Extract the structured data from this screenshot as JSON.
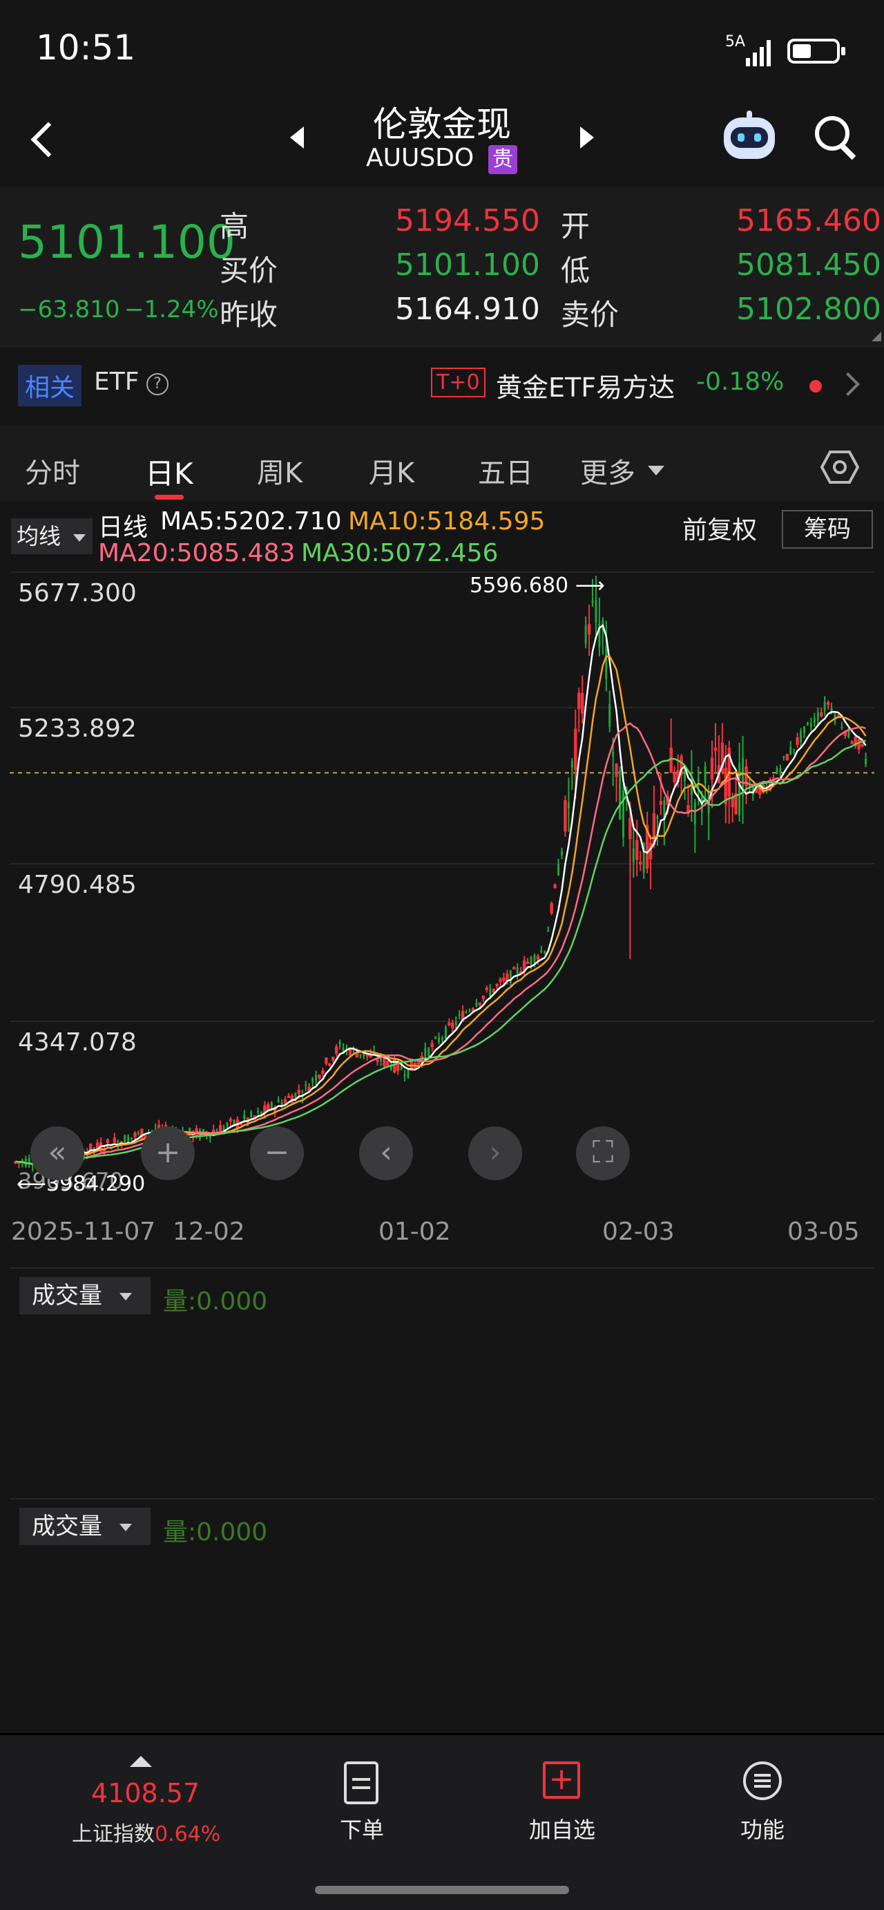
{
  "status": {
    "time": "10:51",
    "network": "5A"
  },
  "header": {
    "title": "伦敦金现",
    "code": "AUUSDO",
    "badge": "贵"
  },
  "quote": {
    "price": "5101.100",
    "change": "−63.810",
    "change_pct": "−1.24%",
    "high_label": "高",
    "high": "5194.550",
    "open_label": "开",
    "open": "5165.460",
    "bid_label": "买价",
    "bid": "5101.100",
    "low_label": "低",
    "low": "5081.450",
    "prev_close_label": "昨收",
    "prev_close": "5164.910",
    "ask_label": "卖价",
    "ask": "5102.800"
  },
  "etf": {
    "related": "相关",
    "etf": "ETF",
    "tag": "T+0",
    "name": "黄金ETF易方达",
    "change": "-0.18%"
  },
  "tabs": [
    "分时",
    "日K",
    "周K",
    "月K",
    "五日",
    "更多"
  ],
  "active_tab": "日K",
  "ma": {
    "selector": "均线",
    "line": "日线",
    "ma5": "MA5:5202.710",
    "ma10": "MA10:5184.595",
    "ma20": "MA20:5085.483",
    "ma30": "MA30:5072.456",
    "adjust": "前复权",
    "chips": "筹码"
  },
  "colors": {
    "up": "#f0343c",
    "down": "#1fa83a",
    "ma5": "#ffffff",
    "ma10": "#f5a623",
    "ma20": "#ff6b81",
    "ma30": "#5fd35f"
  },
  "chart_data": {
    "type": "candlestick",
    "y_ticks": [
      "5677.300",
      "5233.892",
      "4790.485",
      "4347.078",
      "3903.670"
    ],
    "x_ticks": [
      "2025-11-07",
      "12-02",
      "01-02",
      "02-03",
      "03-05"
    ],
    "max_label": "5596.680",
    "min_label": "3984.290",
    "current_line": 5101.1,
    "ylim": [
      3903.67,
      5677.3
    ]
  },
  "volume": [
    {
      "selector": "成交量",
      "value": "量:0.000"
    },
    {
      "selector": "成交量",
      "value": "量:0.000"
    }
  ],
  "bottom": {
    "index_value": "4108.57",
    "index_name": "上证指数",
    "index_pct": "0.64%",
    "order": "下单",
    "add_watch": "加自选",
    "functions": "功能"
  }
}
